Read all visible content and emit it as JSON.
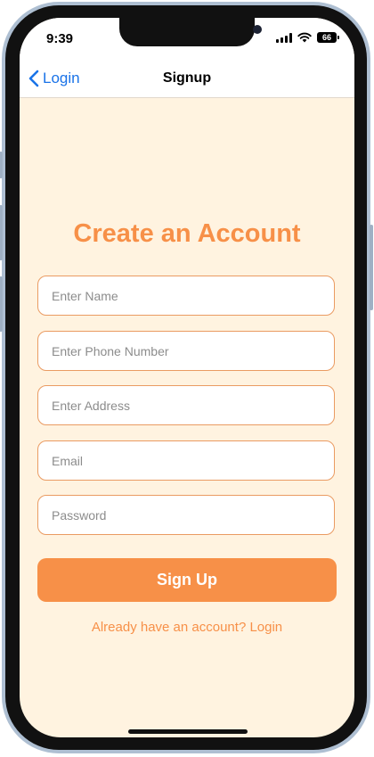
{
  "status_bar": {
    "time": "9:39",
    "battery": "66",
    "icons": [
      "cellular-signal-icon",
      "wifi-icon",
      "battery-icon"
    ]
  },
  "nav": {
    "back_label": "Login",
    "back_icon": "chevron-left-icon",
    "title": "Signup"
  },
  "form": {
    "title": "Create an Account",
    "fields": [
      {
        "placeholder": "Enter Name",
        "value": ""
      },
      {
        "placeholder": "Enter Phone Number",
        "value": ""
      },
      {
        "placeholder": "Enter Address",
        "value": ""
      },
      {
        "placeholder": "Email",
        "value": ""
      },
      {
        "placeholder": "Password",
        "value": ""
      }
    ],
    "submit_label": "Sign Up",
    "login_prompt": "Already have an account? Login"
  },
  "colors": {
    "accent": "#f79048",
    "background": "#fff3e0",
    "link_blue": "#1a73e8"
  }
}
